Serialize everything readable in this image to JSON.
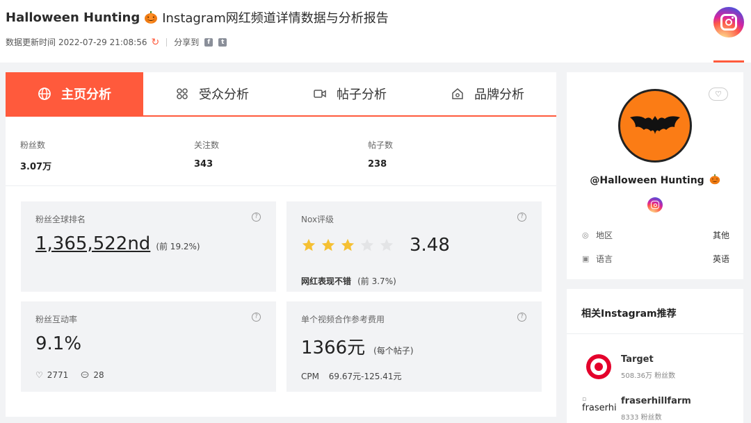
{
  "header": {
    "name": "Halloween Hunting",
    "title_suffix": "Instagram网红频道详情数据与分析报告",
    "update_label": "数据更新时间",
    "update_time": "2022-07-29 21:08:56",
    "share_label": "分享到"
  },
  "tabs": [
    {
      "label": "主页分析",
      "active": true
    },
    {
      "label": "受众分析",
      "active": false
    },
    {
      "label": "帖子分析",
      "active": false
    },
    {
      "label": "品牌分析",
      "active": false
    }
  ],
  "stats": [
    {
      "label": "粉丝数",
      "value": "3.07万"
    },
    {
      "label": "关注数",
      "value": "343"
    },
    {
      "label": "帖子数",
      "value": "238"
    }
  ],
  "cards": {
    "rank": {
      "title": "粉丝全球排名",
      "value": "1,365,522nd",
      "note": "(前 19.2%)"
    },
    "nox": {
      "title": "Nox评级",
      "score": "3.48",
      "stars_filled": 3,
      "stars_total": 5,
      "desc": "网红表现不错",
      "note": "(前 3.7%)"
    },
    "engagement": {
      "title": "粉丝互动率",
      "value": "9.1%",
      "likes": "2771",
      "comments": "28"
    },
    "cost": {
      "title": "单个视频合作参考费用",
      "value": "1366元",
      "unit": "(每个帖子)",
      "cpm_label": "CPM",
      "cpm_value": "69.67元-125.41元"
    }
  },
  "profile": {
    "handle": "@Halloween Hunting",
    "region_label": "地区",
    "region_value": "其他",
    "language_label": "语言",
    "language_value": "英语"
  },
  "recs": {
    "title": "相关Instagram推荐",
    "items": [
      {
        "name": "Target",
        "fans": "508.36万 粉丝数"
      },
      {
        "name": "fraserhillfarm",
        "fans": "8333 粉丝数",
        "broken_alt": "fraserhi"
      }
    ]
  },
  "colors": {
    "accent": "#ff5a3c",
    "star": "#f5c033",
    "star_empty": "#e3e4e6",
    "avatar_bg": "#fb7c15"
  }
}
